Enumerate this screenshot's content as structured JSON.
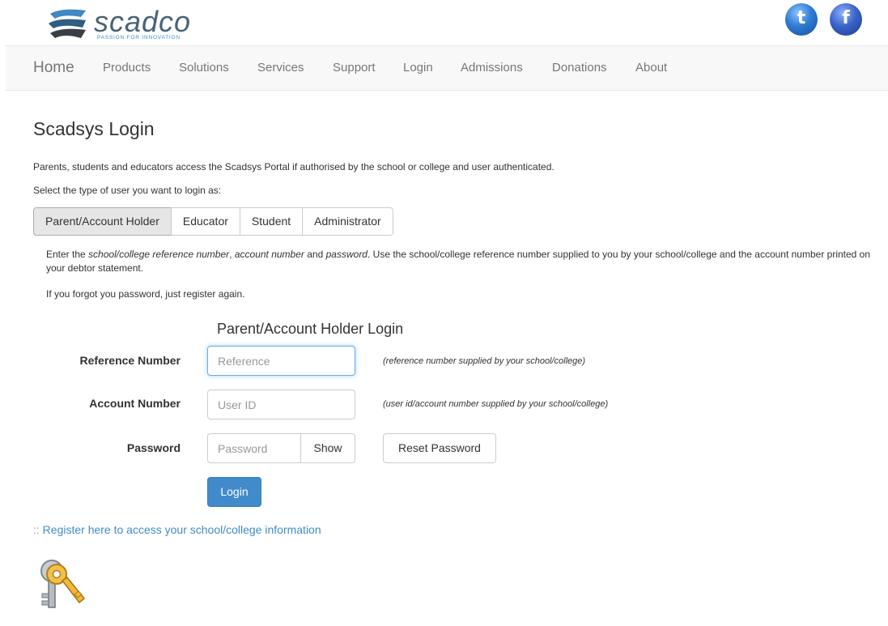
{
  "brand": {
    "name": "scadco",
    "tagline": "PASSION FOR INNOVATION",
    "social": [
      {
        "icon": "twitter-icon",
        "glyph": "t"
      },
      {
        "icon": "facebook-icon",
        "glyph": "f"
      }
    ]
  },
  "nav": {
    "home": "Home",
    "items": [
      "Products",
      "Solutions",
      "Services",
      "Support",
      "Login",
      "Admissions",
      "Donations",
      "About"
    ]
  },
  "page": {
    "title": "Scadsys Login",
    "intro": "Parents, students and educators access the Scadsys Portal if authorised by the school or college and user authenticated.",
    "select_label": "Select the type of user you want to login as:"
  },
  "tabs": [
    {
      "label": "Parent/Account Holder",
      "active": true
    },
    {
      "label": "Educator",
      "active": false
    },
    {
      "label": "Student",
      "active": false
    },
    {
      "label": "Administrator",
      "active": false
    }
  ],
  "instructions": {
    "p1": "Enter the",
    "em1": "school/college reference number",
    "p2": ",",
    "em2": "account number",
    "p3": "and",
    "em3": "password",
    "p4": ". Use the school/college reference number supplied to you by your school/college and the account number printed on your debtor statement.",
    "forgot": "If you forgot you password, just register again."
  },
  "form": {
    "title": "Parent/Account Holder Login",
    "reference": {
      "label": "Reference Number",
      "placeholder": "Reference",
      "value": "",
      "hint": "(reference number supplied by your school/college)"
    },
    "account": {
      "label": "Account Number",
      "placeholder": "User ID",
      "value": "",
      "hint": "(user id/account number supplied by your school/college)"
    },
    "password": {
      "label": "Password",
      "placeholder": "Password",
      "value": "",
      "show_label": "Show"
    },
    "reset_label": "Reset Password",
    "login_label": "Login"
  },
  "register": {
    "prefix": "::",
    "text": "Register here to access your school/college information"
  },
  "colors": {
    "accent": "#428bca",
    "nav_bg": "#f8f8f8",
    "focus": "#66afe9"
  }
}
